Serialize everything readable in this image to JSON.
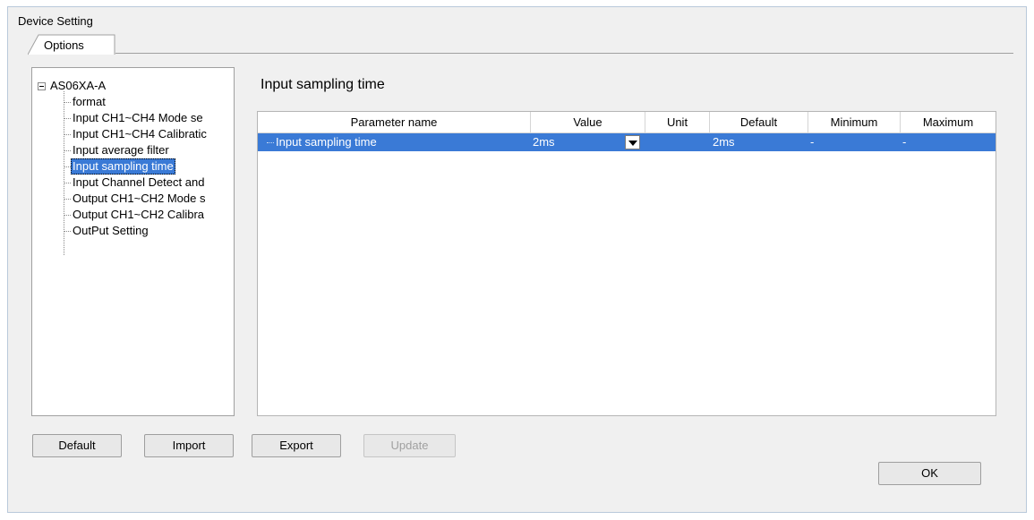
{
  "window": {
    "title": "Device Setting"
  },
  "tabs": [
    {
      "label": "Options"
    }
  ],
  "tree": {
    "root": "AS06XA-A",
    "items": [
      {
        "label": "format"
      },
      {
        "label": "Input CH1~CH4 Mode se"
      },
      {
        "label": "Input CH1~CH4 Calibratic"
      },
      {
        "label": "Input average filter"
      },
      {
        "label": "Input sampling time"
      },
      {
        "label": "Input Channel Detect and"
      },
      {
        "label": "Output CH1~CH2 Mode s"
      },
      {
        "label": "Output CH1~CH2 Calibra"
      },
      {
        "label": "OutPut Setting"
      }
    ],
    "selected_index": 4
  },
  "section_title": "Input sampling time",
  "grid": {
    "columns": [
      "Parameter name",
      "Value",
      "Unit",
      "Default",
      "Minimum",
      "Maximum"
    ],
    "rows": [
      {
        "name": "Input sampling time",
        "value": "2ms",
        "unit": "",
        "default": "2ms",
        "minimum": "-",
        "maximum": "-"
      }
    ]
  },
  "buttons": {
    "default": "Default",
    "import": "Import",
    "export": "Export",
    "update": "Update",
    "ok": "OK"
  },
  "colors": {
    "selection": "#3a7ad6",
    "window_bg": "#f0f0f0"
  }
}
